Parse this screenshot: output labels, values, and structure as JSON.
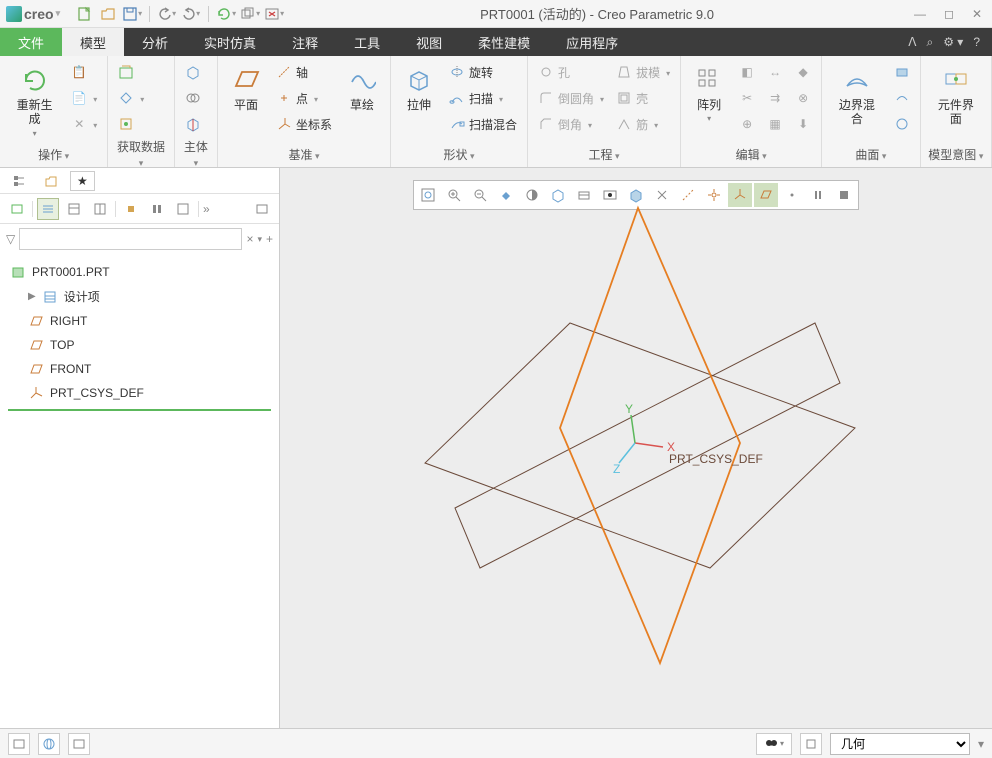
{
  "app": {
    "brand": "creo",
    "title": "PRT0001 (活动的) - Creo Parametric 9.0"
  },
  "tabs": {
    "file": "文件",
    "model": "模型",
    "analysis": "分析",
    "simulation": "实时仿真",
    "annotate": "注释",
    "tools": "工具",
    "view": "视图",
    "flex": "柔性建模",
    "app": "应用程序"
  },
  "ribbon": {
    "ops": {
      "regen": "重新生成",
      "label": "操作"
    },
    "getdata": {
      "label": "获取数据"
    },
    "body": {
      "label": "主体"
    },
    "datum": {
      "plane": "平面",
      "sketch": "草绘",
      "axis": "轴",
      "point": "点",
      "csys": "坐标系",
      "label": "基准"
    },
    "shape": {
      "extrude": "拉伸",
      "revolve": "旋转",
      "sweep": "扫描",
      "sweepblend": "扫描混合",
      "label": "形状"
    },
    "eng": {
      "hole": "孔",
      "round": "倒圆角",
      "chamfer": "倒角",
      "draft": "拔模",
      "shell": "壳",
      "rib": "筋",
      "label": "工程"
    },
    "edit": {
      "pattern": "阵列",
      "label": "编辑"
    },
    "surf": {
      "bblend": "边界混合",
      "label": "曲面"
    },
    "intent": {
      "cinterface": "元件界面",
      "label": "模型意图"
    }
  },
  "tree": {
    "root": "PRT0001.PRT",
    "design": "设计项",
    "right": "RIGHT",
    "top": "TOP",
    "front": "FRONT",
    "csys": "PRT_CSYS_DEF"
  },
  "canvas": {
    "csys_label": "PRT_CSYS_DEF",
    "axes": {
      "x": "X",
      "y": "Y",
      "z": "Z"
    }
  },
  "status": {
    "filter": "几何"
  }
}
